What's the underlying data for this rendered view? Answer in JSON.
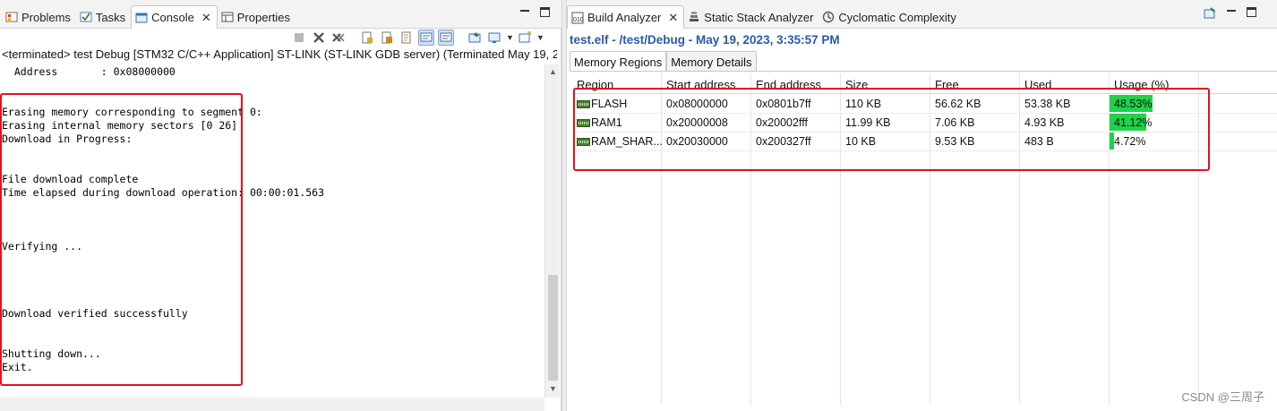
{
  "left": {
    "tabs": [
      {
        "label": "Problems",
        "icon": "problems-icon"
      },
      {
        "label": "Tasks",
        "icon": "tasks-icon"
      },
      {
        "label": "Console",
        "icon": "console-icon",
        "active": true
      },
      {
        "label": "Properties",
        "icon": "properties-icon"
      }
    ],
    "close_glyph": "✕",
    "terminated_line": "<terminated> test Debug [STM32 C/C++ Application] ST-LINK (ST-LINK GDB server) (Terminated May 19, 2",
    "console_lines": [
      "  Address       : 0x08000000",
      "Erasing memory corresponding to segment 0:",
      "Erasing internal memory sectors [0 26]",
      "Download in Progress:",
      "File download complete",
      "Time elapsed during download operation: 00:00:01.563",
      "Verifying ...",
      "Download verified successfully",
      "Shutting down...",
      "Exit."
    ]
  },
  "right": {
    "tabs": [
      {
        "label": "Build Analyzer",
        "icon": "build-analyzer-icon",
        "active": true
      },
      {
        "label": "Static Stack Analyzer",
        "icon": "stack-analyzer-icon"
      },
      {
        "label": "Cyclomatic Complexity",
        "icon": "cyclomatic-icon"
      }
    ],
    "elf_title": "test.elf - /test/Debug - May 19, 2023, 3:35:57 PM",
    "subtabs": [
      "Memory Regions",
      "Memory Details"
    ],
    "columns": [
      "Region",
      "Start address",
      "End address",
      "Size",
      "Free",
      "Used",
      "Usage (%)"
    ],
    "rows": [
      {
        "region": "FLASH",
        "start": "0x08000000",
        "end": "0x0801b7ff",
        "size": "110 KB",
        "free": "56.62 KB",
        "used": "53.38 KB",
        "usage": "48.53%",
        "usage_value": 48.53
      },
      {
        "region": "RAM1",
        "start": "0x20000008",
        "end": "0x20002fff",
        "size": "11.99 KB",
        "free": "7.06 KB",
        "used": "4.93 KB",
        "usage": "41.12%",
        "usage_value": 41.12
      },
      {
        "region": "RAM_SHAR...",
        "start": "0x20030000",
        "end": "0x200327ff",
        "size": "10 KB",
        "free": "9.53 KB",
        "used": "483 B",
        "usage": "4.72%",
        "usage_value": 4.72
      }
    ]
  },
  "watermark": "CSDN @三周子",
  "colors": {
    "highlight_box": "#e2121e",
    "usage_bar": "#1fd24a",
    "title_blue": "#2a5aa6"
  }
}
